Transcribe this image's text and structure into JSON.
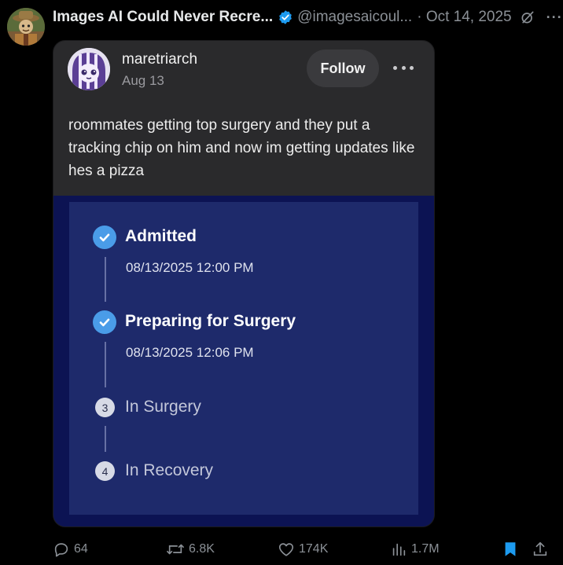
{
  "outer_tweet": {
    "author_name": "Images AI Could Never Recre...",
    "handle": "@imagesaicoul...",
    "date": "· Oct 14, 2025",
    "avatar_icon": "scarecrow-avatar",
    "verified_color": "#1d9bf0"
  },
  "embedded_post": {
    "username": "maretriarch",
    "date": "Aug 13",
    "follow_label": "Follow",
    "text": "roommates getting top surgery and they put a tracking chip on him and now im getting updates like hes a pizza",
    "avatar_icon": "purple-haired-character-avatar"
  },
  "tracker": {
    "steps": [
      {
        "marker": "check",
        "title": "Admitted",
        "time": "08/13/2025 12:00 PM",
        "status": "done"
      },
      {
        "marker": "check",
        "title": "Preparing for Surgery",
        "time": "08/13/2025 12:06 PM",
        "status": "done"
      },
      {
        "marker": "3",
        "title": "In Surgery",
        "status": "pending"
      },
      {
        "marker": "4",
        "title": "In Recovery",
        "status": "pending"
      }
    ],
    "colors": {
      "outer": "#0c1353",
      "panel": "#1e2a6b",
      "check": "#4a9ce8"
    }
  },
  "actions": {
    "replies": "64",
    "reposts": "6.8K",
    "likes": "174K",
    "views": "1.7M",
    "bookmark_color": "#1d9bf0"
  }
}
